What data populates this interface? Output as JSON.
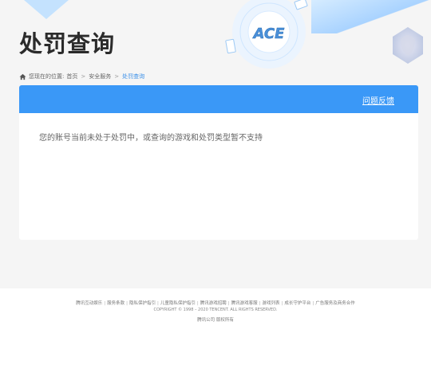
{
  "header": {
    "title": "处罚查询",
    "logo_text": "ACE"
  },
  "breadcrumb": {
    "prefix": "您现在的位置:",
    "items": [
      "首页",
      "安全服务"
    ],
    "separator": ">",
    "current": "处罚查询"
  },
  "panel": {
    "feedback_label": "问题反馈",
    "message": "您的账号当前未处于处罚中，或查询的游戏和处罚类型暂不支持"
  },
  "footer": {
    "links": [
      "腾讯互动娱乐",
      "服务条款",
      "隐私保护指引",
      "儿童隐私保护指引",
      "腾讯游戏招聘",
      "腾讯游戏客服",
      "游戏列表",
      "成长守护平台",
      "广告服务及商务合作"
    ],
    "copyright": "COPYRIGHT © 1998 – 2020 TENCENT. ALL RIGHTS RESERVED.",
    "rights": "腾讯公司 版权所有"
  },
  "colors": {
    "accent": "#3a98f7",
    "link_current": "#3a8fe8",
    "page_bg": "#f5f5f5"
  }
}
